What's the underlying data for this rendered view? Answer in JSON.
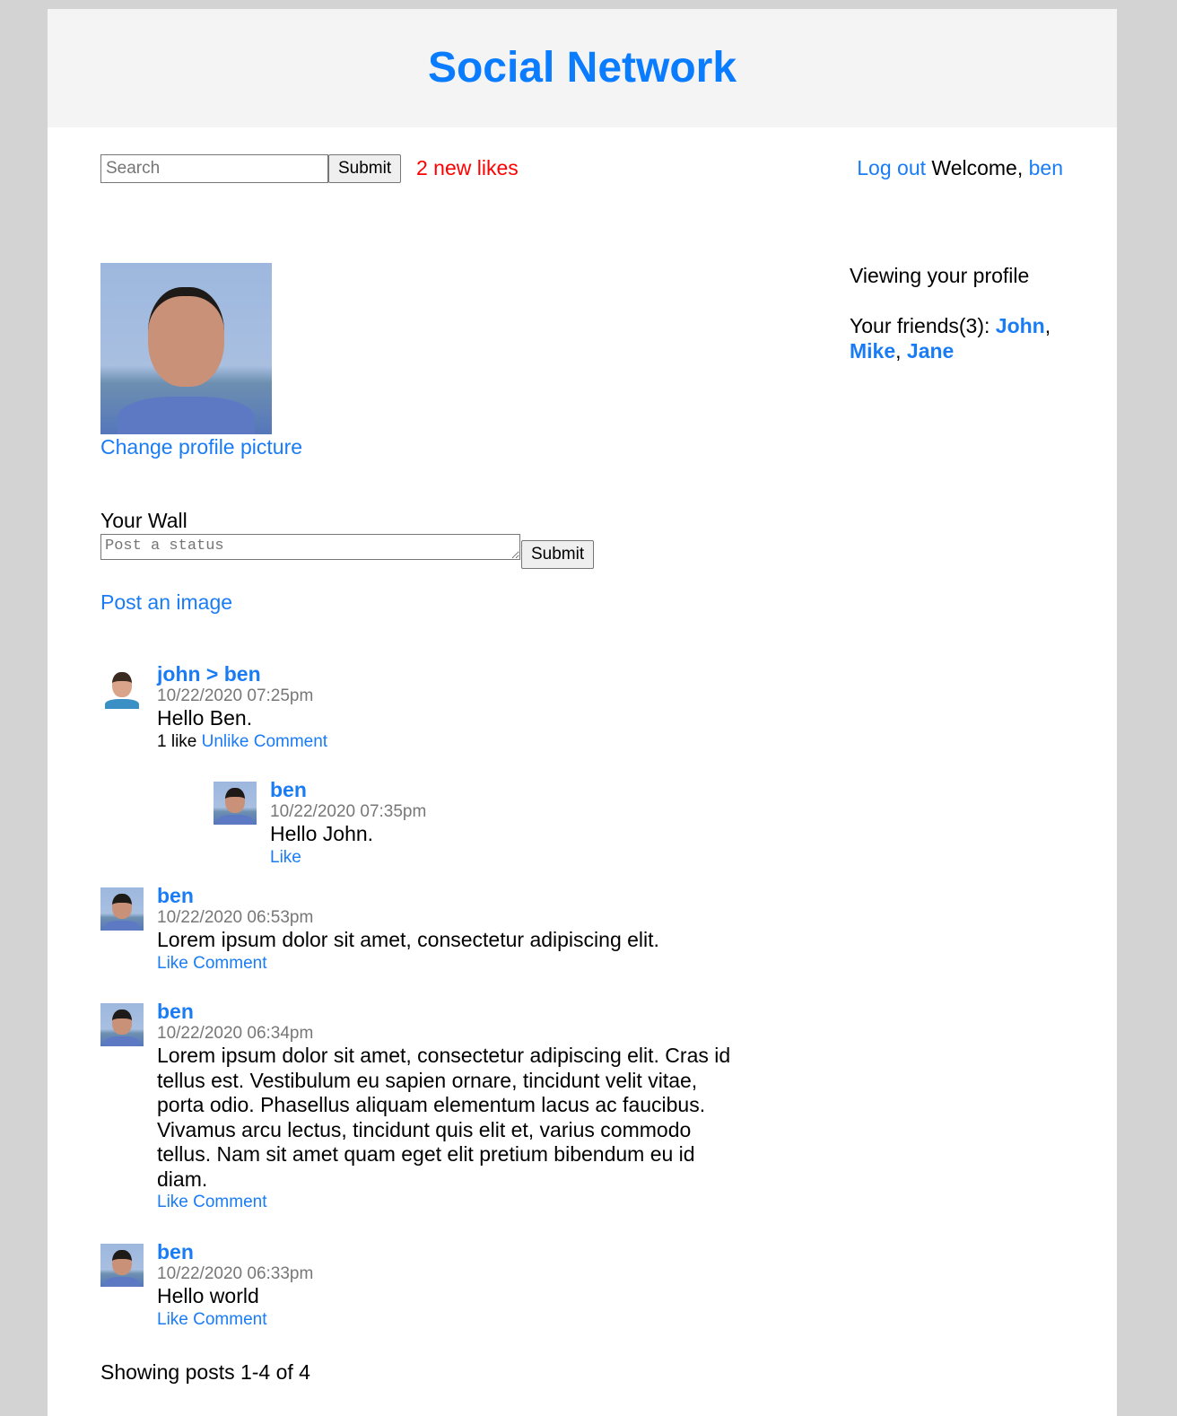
{
  "header": {
    "title": "Social Network"
  },
  "topbar": {
    "search_placeholder": "Search",
    "submit_label": "Submit",
    "notifications": "2 new likes",
    "logout_label": "Log out",
    "welcome_text": "Welcome,",
    "username": "ben"
  },
  "profile": {
    "change_picture_label": "Change profile picture",
    "viewing_text": "Viewing your profile",
    "friends_label": "Your friends(3):",
    "friends": [
      "John",
      "Mike",
      "Jane"
    ]
  },
  "wall": {
    "title": "Your Wall",
    "status_placeholder": "Post a status",
    "submit_label": "Submit",
    "post_image_label": "Post an image"
  },
  "posts": [
    {
      "author": "john > ben",
      "time": "10/22/2020 07:25pm",
      "text": "Hello Ben.",
      "likes": "1 like",
      "actions": [
        "Unlike",
        "Comment"
      ],
      "reply": {
        "author": "ben",
        "time": "10/22/2020 07:35pm",
        "text": "Hello John.",
        "actions": [
          "Like"
        ]
      }
    },
    {
      "author": "ben",
      "time": "10/22/2020 06:53pm",
      "text": "Lorem ipsum dolor sit amet, consectetur adipiscing elit.",
      "actions": [
        "Like",
        "Comment"
      ]
    },
    {
      "author": "ben",
      "time": "10/22/2020 06:34pm",
      "text": "Lorem ipsum dolor sit amet, consectetur adipiscing elit. Cras id tellus est. Vestibulum eu sapien ornare, tincidunt velit vitae, porta odio. Phasellus aliquam elementum lacus ac faucibus. Vivamus arcu lectus, tincidunt quis elit et, varius commodo tellus. Nam sit amet quam eget elit pretium bibendum eu id diam.",
      "actions": [
        "Like",
        "Comment"
      ]
    },
    {
      "author": "ben",
      "time": "10/22/2020 06:33pm",
      "text": "Hello world",
      "actions": [
        "Like",
        "Comment"
      ]
    }
  ],
  "pagination": {
    "text": "Showing posts 1-4 of 4"
  },
  "colors": {
    "link": "#1a7cf5",
    "title": "#0a7cff",
    "notification": "#ff0000",
    "header_bg": "#f4f4f4",
    "page_bg": "#d3d3d3"
  }
}
